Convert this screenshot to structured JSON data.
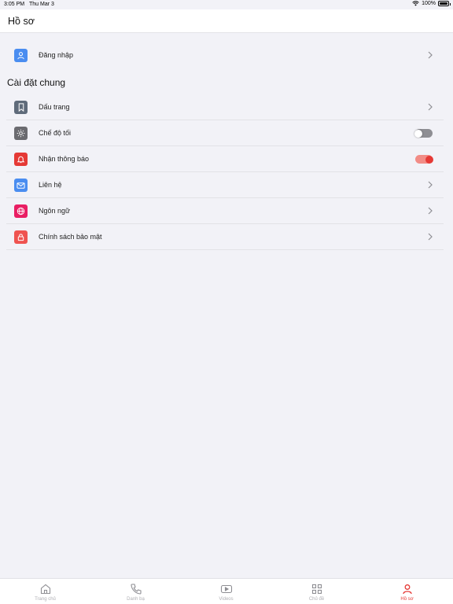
{
  "status_bar": {
    "time": "3:05 PM",
    "date": "Thu Mar 3",
    "battery": "100%"
  },
  "header": {
    "title": "Hồ sơ"
  },
  "login": {
    "label": "Đăng nhập",
    "icon": "user-icon",
    "color": "#3b82f6"
  },
  "section": {
    "title": "Cài đặt chung"
  },
  "settings": [
    {
      "label": "Dấu trang",
      "icon": "bookmark-icon",
      "color": "#5f6b7a",
      "control": "chevron"
    },
    {
      "label": "Chế độ tối",
      "icon": "sun-icon",
      "color": "#6b6b70",
      "control": "toggle",
      "on": false
    },
    {
      "label": "Nhận thông báo",
      "icon": "bell-icon",
      "color": "#e53935",
      "control": "toggle",
      "on": true
    },
    {
      "label": "Liên hệ",
      "icon": "mail-icon",
      "color": "#3b82f6",
      "control": "chevron"
    },
    {
      "label": "Ngôn ngữ",
      "icon": "globe-icon",
      "color": "#e91e63",
      "control": "chevron"
    },
    {
      "label": "Chính sách bảo mật",
      "icon": "lock-icon",
      "color": "#ef5350",
      "control": "chevron"
    }
  ],
  "tabs": [
    {
      "label": "Trang chủ",
      "icon": "home-icon",
      "active": false
    },
    {
      "label": "Danh bạ",
      "icon": "phone-icon",
      "active": false
    },
    {
      "label": "Videos",
      "icon": "video-icon",
      "active": false
    },
    {
      "label": "Chủ đề",
      "icon": "grid-icon",
      "active": false
    },
    {
      "label": "Hồ sơ",
      "icon": "user-icon",
      "active": true
    }
  ],
  "colors": {
    "accent": "#e53935",
    "inactive_tab": "#b0b0b5"
  }
}
